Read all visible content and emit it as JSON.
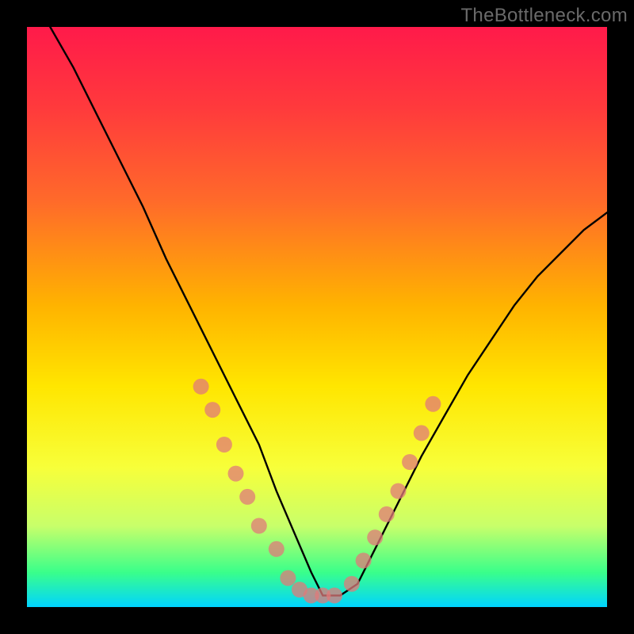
{
  "watermark": "TheBottleneck.com",
  "chart_data": {
    "type": "line",
    "title": "",
    "xlabel": "",
    "ylabel": "",
    "xlim": [
      0,
      100
    ],
    "ylim": [
      0,
      100
    ],
    "series": [
      {
        "name": "bottleneck-curve",
        "x": [
          4,
          8,
          12,
          16,
          20,
          24,
          28,
          32,
          36,
          40,
          43,
          46,
          49,
          51,
          54,
          57,
          60,
          64,
          68,
          72,
          76,
          80,
          84,
          88,
          92,
          96,
          100
        ],
        "y": [
          100,
          93,
          85,
          77,
          69,
          60,
          52,
          44,
          36,
          28,
          20,
          13,
          6,
          2,
          2,
          4,
          10,
          18,
          26,
          33,
          40,
          46,
          52,
          57,
          61,
          65,
          68
        ]
      }
    ],
    "markers": {
      "name": "highlight-dots",
      "color": "#e07a7a",
      "radius_px": 10,
      "points_xy": [
        [
          30,
          38
        ],
        [
          32,
          34
        ],
        [
          34,
          28
        ],
        [
          36,
          23
        ],
        [
          38,
          19
        ],
        [
          40,
          14
        ],
        [
          43,
          10
        ],
        [
          45,
          5
        ],
        [
          47,
          3
        ],
        [
          49,
          2
        ],
        [
          51,
          2
        ],
        [
          53,
          2
        ],
        [
          56,
          4
        ],
        [
          58,
          8
        ],
        [
          60,
          12
        ],
        [
          62,
          16
        ],
        [
          64,
          20
        ],
        [
          66,
          25
        ],
        [
          68,
          30
        ],
        [
          70,
          35
        ]
      ]
    }
  }
}
